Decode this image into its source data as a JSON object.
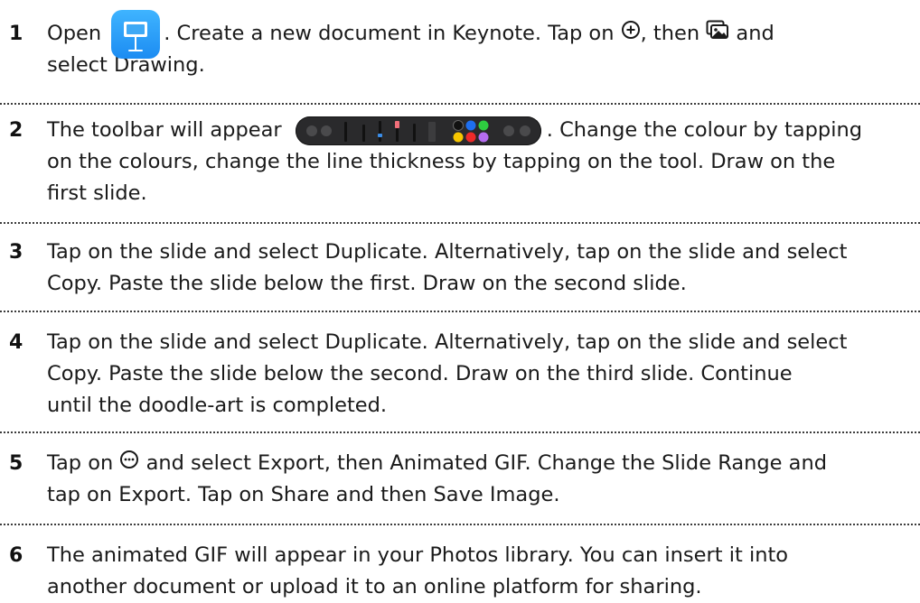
{
  "steps": [
    {
      "number": "1",
      "lines": [
        [
          "Open ",
          "keynote-app-icon",
          ". Create a new document in Keynote. Tap on ",
          "plus-circle-icon",
          ", then ",
          "media-icon",
          " and"
        ],
        [
          "select Drawing."
        ]
      ]
    },
    {
      "number": "2",
      "lines": [
        [
          "The toolbar will appear ",
          "drawing-toolbar-icon",
          ". Change the colour by tapping"
        ],
        [
          "on the colours, change the line thickness by tapping on the tool. Draw on the"
        ],
        [
          "first slide."
        ]
      ]
    },
    {
      "number": "3",
      "lines": [
        [
          "Tap on the slide and select Duplicate. Alternatively, tap on the slide and select"
        ],
        [
          "Copy. Paste the slide below the first. Draw on the second slide."
        ]
      ]
    },
    {
      "number": "4",
      "lines": [
        [
          "Tap on the slide and select Duplicate. Alternatively, tap on the slide and select"
        ],
        [
          "Copy. Paste the slide below the second. Draw on the third slide. Continue"
        ],
        [
          "until the doodle-art is completed."
        ]
      ]
    },
    {
      "number": "5",
      "lines": [
        [
          "Tap on ",
          "more-circle-icon",
          " and select Export, then Animated GIF. Change the Slide Range and"
        ],
        [
          "tap on Export. Tap on Share and then Save Image."
        ]
      ]
    },
    {
      "number": "6",
      "lines": [
        [
          "The animated GIF will appear in your Photos library. You can insert it into"
        ],
        [
          "another document or upload it to an online platform for sharing."
        ]
      ]
    }
  ],
  "colors": {
    "divider": "#3c3c3c",
    "keynote_blue": "#1c8cf2",
    "toolbar_bg": "#2a2a2c",
    "swatch_black": "#111111",
    "swatch_blue": "#1e6ff0",
    "swatch_green": "#2ecc40",
    "swatch_yellow": "#f7c600",
    "swatch_red": "#ee2a2a"
  }
}
